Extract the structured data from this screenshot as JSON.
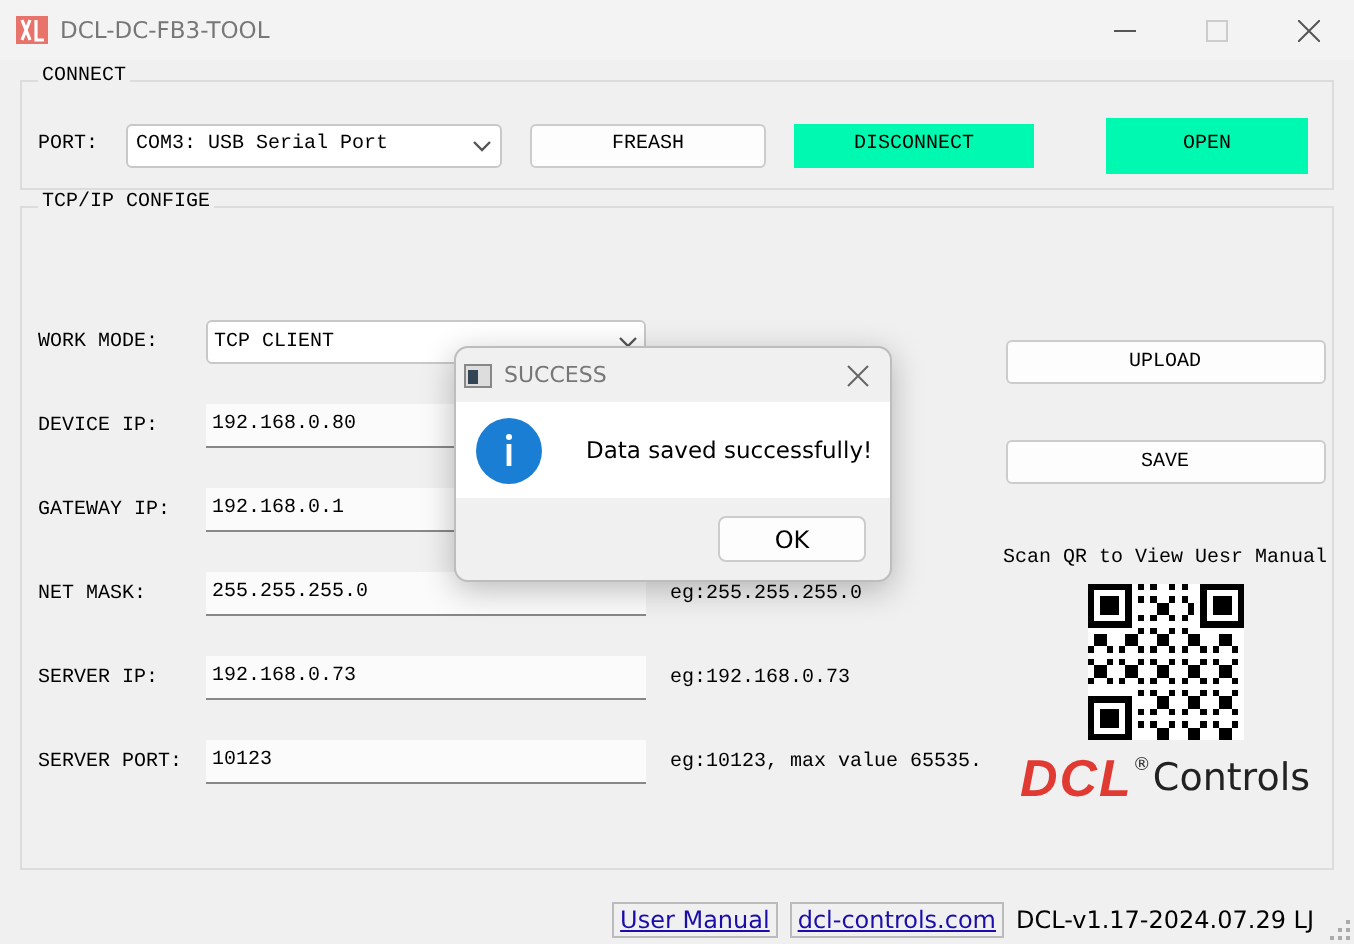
{
  "window": {
    "title": "DCL-DC-FB3-TOOL"
  },
  "connect": {
    "title": "CONNECT",
    "port_label": "PORT:",
    "port_value": "COM3: USB Serial Port",
    "buttons": [
      {
        "label": "FREASH",
        "highlighted": false
      },
      {
        "label": "DISCONNECT",
        "highlighted": true
      },
      {
        "label": "OPEN",
        "highlighted": true
      }
    ]
  },
  "tcp": {
    "title": "TCP/IP CONFIGE",
    "fields": [
      {
        "kind": "select",
        "label": "WORK MODE:",
        "value": "TCP CLIENT"
      },
      {
        "kind": "input",
        "label": "DEVICE IP:",
        "value": "192.168.0.80"
      },
      {
        "kind": "input",
        "label": "GATEWAY IP:",
        "value": "192.168.0.1"
      },
      {
        "kind": "input",
        "label": "NET MASK:",
        "value": "255.255.255.0",
        "hint": "eg:255.255.255.0"
      },
      {
        "kind": "input",
        "label": "SERVER IP:",
        "value": "192.168.0.73",
        "hint": "eg:192.168.0.73"
      },
      {
        "kind": "input",
        "label": "SERVER PORT:",
        "value": "10123",
        "hint": "eg:10123, max value 65535."
      }
    ],
    "actions": [
      "UPLOAD",
      "SAVE"
    ],
    "qr_caption": "Scan QR to View Uesr Manual",
    "logo": {
      "mark": "DCL",
      "registered": "®",
      "text": "Controls"
    }
  },
  "dialog": {
    "title": "SUCCESS",
    "message": "Data saved successfully!",
    "button": "OK"
  },
  "status_bar": {
    "links": [
      "User Manual",
      "dcl-controls.com"
    ],
    "version": "DCL-v1.17-2024.07.29 LJ"
  }
}
